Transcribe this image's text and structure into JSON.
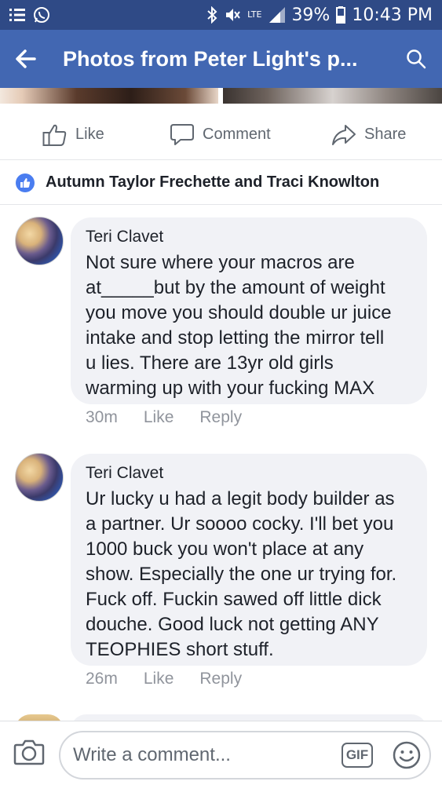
{
  "status_bar": {
    "battery_percent": "39%",
    "time": "10:43 PM",
    "network": "LTE",
    "icons": [
      "notification-list-icon",
      "whatsapp-icon",
      "bluetooth-icon",
      "mute-icon",
      "signal-icon",
      "battery-icon"
    ]
  },
  "header": {
    "title": "Photos from Peter Light's p...",
    "back_icon": "back-arrow-icon",
    "search_icon": "search-icon",
    "background": "#4267b2"
  },
  "actions": {
    "like_label": "Like",
    "comment_label": "Comment",
    "share_label": "Share"
  },
  "reactions": {
    "names": "Autumn Taylor Frechette and Traci Knowlton",
    "icon": "like-badge-icon"
  },
  "comments": [
    {
      "author": "Teri Clavet",
      "text": "Not sure where your macros are\nat_____but by the amount of weight\nyou move you should double ur juice\nintake and stop letting the mirror tell\nu lies.  There are 13yr old girls\nwarming up with your fucking MAX",
      "time": "30m",
      "like_label": "Like",
      "reply_label": "Reply"
    },
    {
      "author": "Teri Clavet",
      "text": "Ur lucky u had a legit body builder as\na partner. Ur soooo cocky. I'll bet you\n1000 buck you won't place at any\nshow. Especially the one ur trying for.\nFuck off. Fuckin sawed off little dick\ndouche.  Good luck not getting ANY\nTEOPHIES short stuff.",
      "time": "26m",
      "like_label": "Like",
      "reply_label": "Reply"
    }
  ],
  "composer": {
    "placeholder": "Write a comment...",
    "gif_label": "GIF",
    "camera_icon": "camera-icon",
    "emoji_icon": "smiley-icon"
  }
}
